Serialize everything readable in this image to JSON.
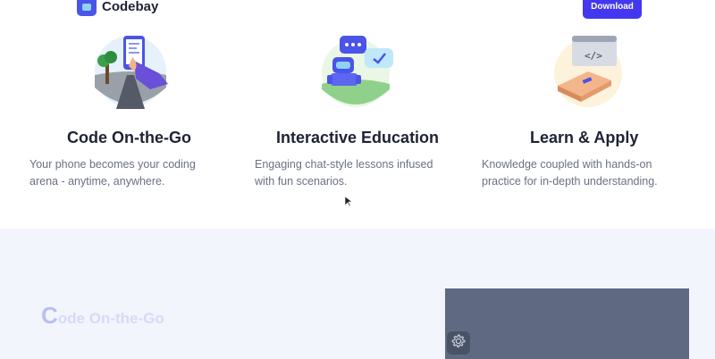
{
  "header": {
    "brand": "Codebay",
    "download_label": "Download"
  },
  "features": [
    {
      "title": "Code On-the-Go",
      "description": "Your phone becomes your coding arena - anytime, anywhere.",
      "icon": "phone-coding-illustration"
    },
    {
      "title": "Interactive Education",
      "description": "Engaging chat-style lessons infused with fun scenarios.",
      "icon": "robot-chat-illustration"
    },
    {
      "title": "Learn & Apply",
      "description": "Knowledge coupled with hands-on practice for in-depth understanding.",
      "icon": "book-code-illustration"
    }
  ],
  "section2": {
    "heading_first_letter": "C",
    "heading_rest": "ode On-the-Go",
    "settings_icon": "gear-icon"
  },
  "colors": {
    "brand": "#4338f0",
    "heading": "#1e2235",
    "body_text": "#6b7085",
    "section_bg": "#f3f5fc",
    "video_panel": "#5f6a82"
  }
}
